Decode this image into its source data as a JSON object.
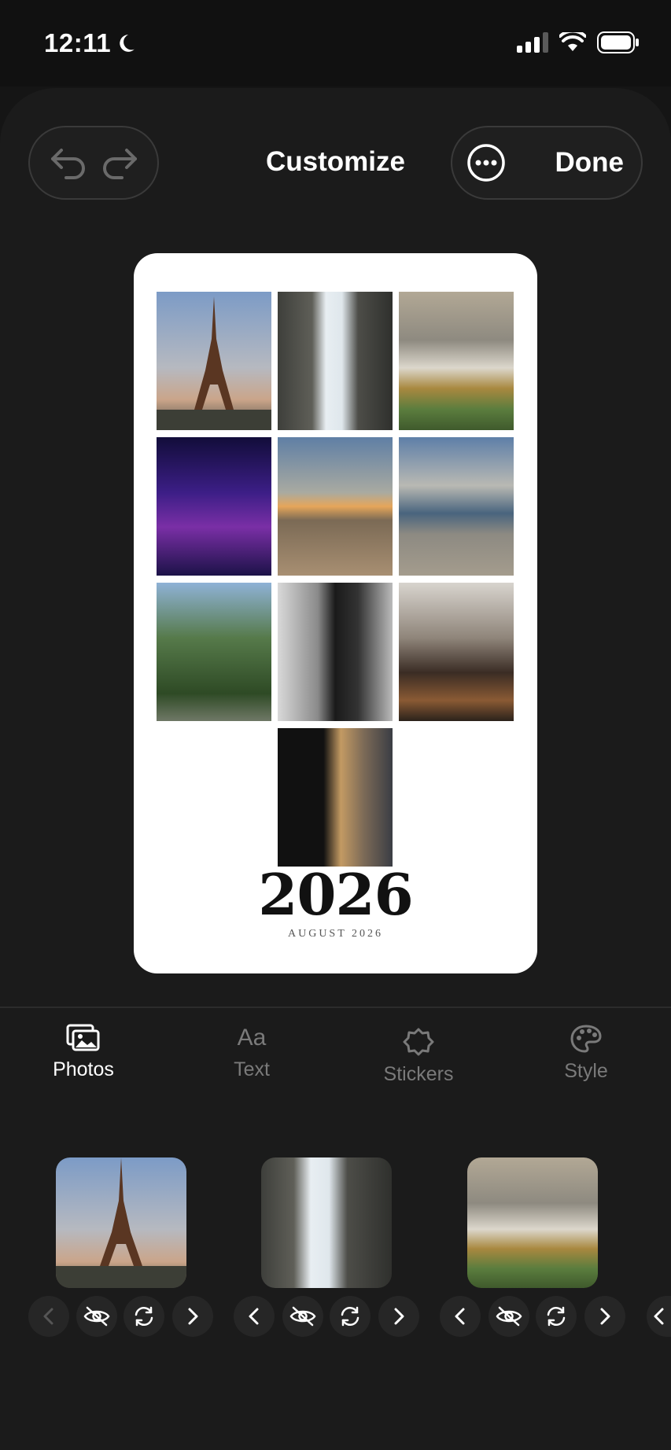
{
  "status_bar": {
    "time": "12:11"
  },
  "header": {
    "title": "Customize",
    "done_label": "Done"
  },
  "poster": {
    "year": "2026",
    "month": "AUGUST 2026"
  },
  "tabs": [
    {
      "label": "Photos",
      "icon": "photos-icon",
      "active": true
    },
    {
      "label": "Text",
      "icon": "text-aa-icon",
      "active": false
    },
    {
      "label": "Stickers",
      "icon": "sticker-icon",
      "active": false
    },
    {
      "label": "Style",
      "icon": "palette-icon",
      "active": false
    }
  ],
  "tab_icon_text": "Aa",
  "colors": {
    "background": "#151515",
    "sheet": "#1b1b1b",
    "card": "#ffffff",
    "active_tab": "#ffffff",
    "inactive_tab": "#7a7a7a"
  }
}
